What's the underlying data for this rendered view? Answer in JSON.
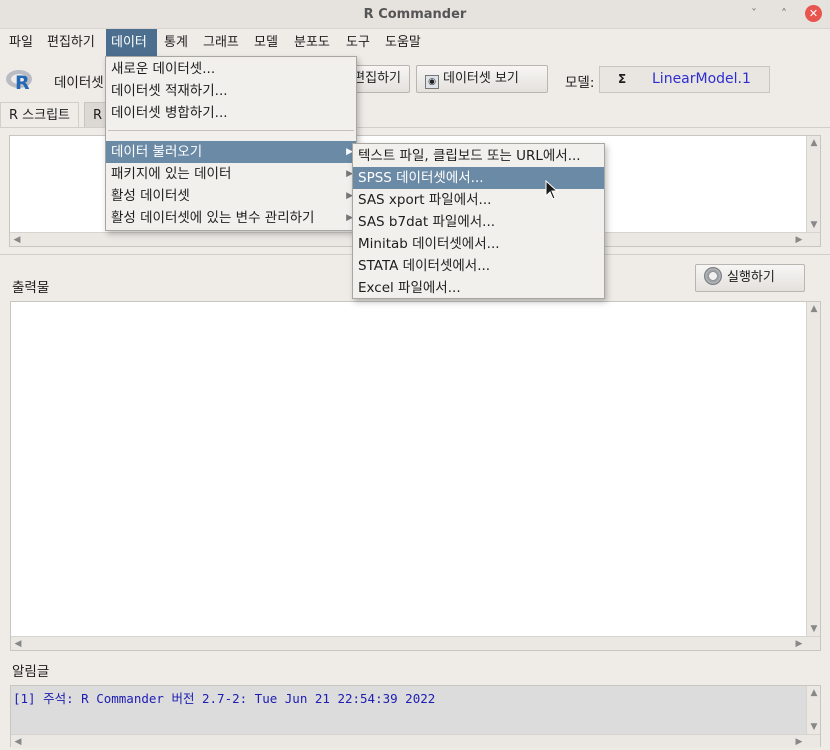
{
  "window": {
    "title": "R Commander",
    "minimize": "ˇ",
    "restore": "˄",
    "close": "✕"
  },
  "menubar": [
    {
      "label": "파일"
    },
    {
      "label": "편집하기"
    },
    {
      "label": "데이터"
    },
    {
      "label": "통계"
    },
    {
      "label": "그래프"
    },
    {
      "label": "모델"
    },
    {
      "label": "분포도"
    },
    {
      "label": "도구"
    },
    {
      "label": "도움말"
    }
  ],
  "toolbar": {
    "dataset_label": "데이터셋",
    "edit_button": "편집하기",
    "view_button": "데이터셋 보기",
    "model_label": "모델:",
    "model_icon": "Σ",
    "model_value": "LinearModel.1"
  },
  "tabs": {
    "script": "R 스크립트",
    "markdown": "R"
  },
  "output": {
    "label": "출력물",
    "run_button": "실행하기"
  },
  "messages": {
    "label": "알림글",
    "line": "[1] 주석: R Commander 버전 2.7-2: Tue Jun 21 22:54:39 2022"
  },
  "data_menu": {
    "items": [
      {
        "label": "새로운 데이터셋..."
      },
      {
        "label": "데이터셋 적재하기..."
      },
      {
        "label": "데이터셋 병합하기..."
      },
      {
        "label": "데이터 불러오기",
        "submenu": true
      },
      {
        "label": "패키지에 있는 데이터",
        "submenu": true
      },
      {
        "label": "활성 데이터셋",
        "submenu": true
      },
      {
        "label": "활성 데이터셋에 있는 변수 관리하기",
        "submenu": true
      }
    ]
  },
  "import_submenu": {
    "items": [
      {
        "label": "텍스트 파일, 클립보드 또는 URL에서..."
      },
      {
        "label": "SPSS 데이터셋에서..."
      },
      {
        "label": "SAS xport 파일에서..."
      },
      {
        "label": "SAS b7dat 파일에서..."
      },
      {
        "label": "Minitab 데이터셋에서..."
      },
      {
        "label": "STATA 데이터셋에서..."
      },
      {
        "label": "Excel 파일에서..."
      }
    ]
  },
  "colors": {
    "menu_active": "#4d6f8f",
    "menu_highlight": "#6b8aa6",
    "message_text": "#1d1db4",
    "close_button": "#e8554e",
    "model_text": "#2e2ed0"
  }
}
